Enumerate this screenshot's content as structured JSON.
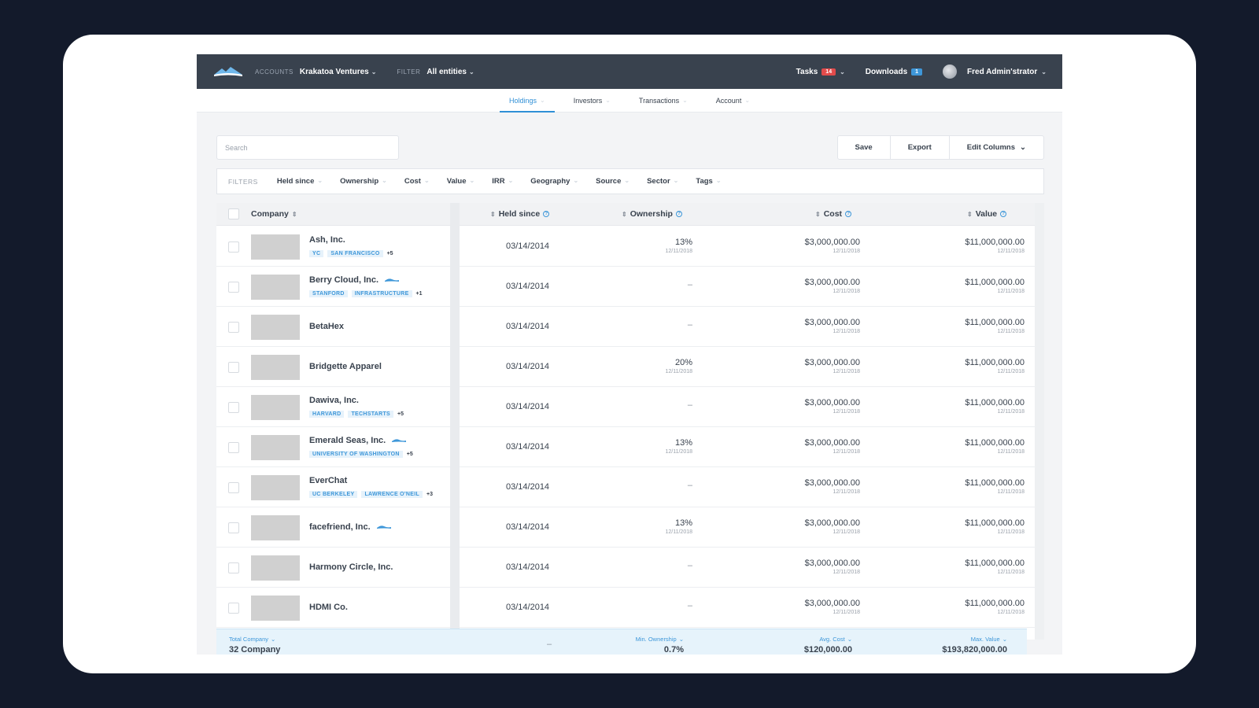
{
  "topbar": {
    "accounts_label": "ACCOUNTS",
    "account_name": "Krakatoa Ventures",
    "filter_label": "FILTER",
    "filter_value": "All entities",
    "tasks_label": "Tasks",
    "tasks_count": "14",
    "downloads_label": "Downloads",
    "downloads_count": "1",
    "user_name": "Fred Admin'strator",
    "colors": {
      "bar": "#39424e",
      "tasks_badge": "#e24b4b",
      "downloads_badge": "#3e97d9"
    }
  },
  "nav": {
    "tabs": [
      {
        "label": "Holdings",
        "active": true
      },
      {
        "label": "Investors"
      },
      {
        "label": "Transactions"
      },
      {
        "label": "Account"
      }
    ]
  },
  "toolbar": {
    "search_placeholder": "Search",
    "save_label": "Save",
    "export_label": "Export",
    "edit_columns_label": "Edit Columns"
  },
  "filters": {
    "label": "FILTERS",
    "items": [
      "Held since",
      "Ownership",
      "Cost",
      "Value",
      "IRR",
      "Geography",
      "Source",
      "Sector",
      "Tags"
    ]
  },
  "table": {
    "columns": {
      "company": "Company",
      "held_since": "Held since",
      "ownership": "Ownership",
      "cost": "Cost",
      "value": "Value"
    },
    "rows": [
      {
        "name": "Ash, Inc.",
        "tags": [
          "YC",
          "SAN FRANCISCO"
        ],
        "more": "+5",
        "held_since": "03/14/2014",
        "ownership": "13%",
        "ownership_date": "12/11/2018",
        "cost": "$3,000,000.00",
        "cost_date": "12/11/2018",
        "value": "$11,000,000.00",
        "value_date": "12/11/2018"
      },
      {
        "name": "Berry Cloud, Inc.",
        "wave": true,
        "tags": [
          "STANFORD",
          "INFRASTRUCTURE"
        ],
        "more": "+1",
        "held_since": "03/14/2014",
        "ownership": "–",
        "cost": "$3,000,000.00",
        "cost_date": "12/11/2018",
        "value": "$11,000,000.00",
        "value_date": "12/11/2018"
      },
      {
        "name": "BetaHex",
        "held_since": "03/14/2014",
        "ownership": "–",
        "cost": "$3,000,000.00",
        "cost_date": "12/11/2018",
        "value": "$11,000,000.00",
        "value_date": "12/11/2018"
      },
      {
        "name": "Bridgette Apparel",
        "held_since": "03/14/2014",
        "ownership": "20%",
        "ownership_date": "12/11/2018",
        "cost": "$3,000,000.00",
        "cost_date": "12/11/2018",
        "value": "$11,000,000.00",
        "value_date": "12/11/2018"
      },
      {
        "name": "Dawiva, Inc.",
        "tags": [
          "HARVARD",
          "TECHSTARTS"
        ],
        "more": "+5",
        "held_since": "03/14/2014",
        "ownership": "–",
        "cost": "$3,000,000.00",
        "cost_date": "12/11/2018",
        "value": "$11,000,000.00",
        "value_date": "12/11/2018"
      },
      {
        "name": "Emerald Seas, Inc.",
        "wave": true,
        "tags": [
          "UNIVERSITY OF WASHINGTON"
        ],
        "more": "+5",
        "held_since": "03/14/2014",
        "ownership": "13%",
        "ownership_date": "12/11/2018",
        "cost": "$3,000,000.00",
        "cost_date": "12/11/2018",
        "value": "$11,000,000.00",
        "value_date": "12/11/2018"
      },
      {
        "name": "EverChat",
        "tags": [
          "UC BERKELEY",
          "LAWRENCE O'NEIL"
        ],
        "more": "+3",
        "held_since": "03/14/2014",
        "ownership": "–",
        "cost": "$3,000,000.00",
        "cost_date": "12/11/2018",
        "value": "$11,000,000.00",
        "value_date": "12/11/2018"
      },
      {
        "name": "facefriend, Inc.",
        "wave": true,
        "held_since": "03/14/2014",
        "ownership": "13%",
        "ownership_date": "12/11/2018",
        "cost": "$3,000,000.00",
        "cost_date": "12/11/2018",
        "value": "$11,000,000.00",
        "value_date": "12/11/2018"
      },
      {
        "name": "Harmony Circle, Inc.",
        "held_since": "03/14/2014",
        "ownership": "–",
        "cost": "$3,000,000.00",
        "cost_date": "12/11/2018",
        "value": "$11,000,000.00",
        "value_date": "12/11/2018"
      },
      {
        "name": "HDMI Co.",
        "held_since": "03/14/2014",
        "ownership": "–",
        "cost": "$3,000,000.00",
        "cost_date": "12/11/2018",
        "value": "$11,000,000.00",
        "value_date": "12/11/2018"
      }
    ]
  },
  "footer": {
    "total_label": "Total Company",
    "total_value": "32 Company",
    "held_dash": "–",
    "min_ownership_label": "Min. Ownership",
    "min_ownership_value": "0.7%",
    "avg_cost_label": "Avg. Cost",
    "avg_cost_value": "$120,000.00",
    "max_value_label": "Max. Value",
    "max_value_value": "$193,820,000.00"
  }
}
